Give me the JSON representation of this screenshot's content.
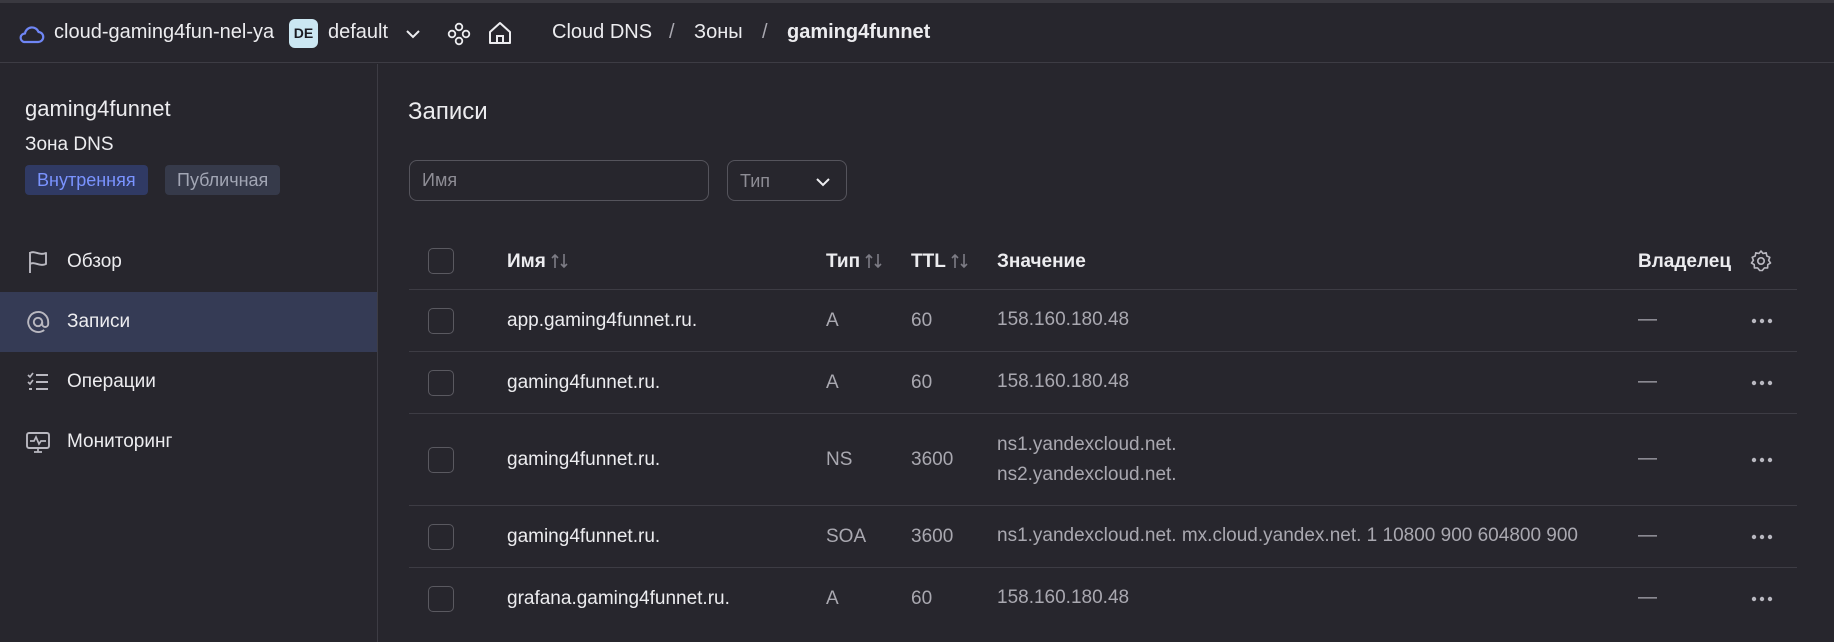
{
  "header": {
    "cloud_name": "cloud-gaming4fun-nel-ya",
    "folder_badge": "DE",
    "folder_name": "default",
    "breadcrumbs": [
      {
        "label": "Cloud DNS"
      },
      {
        "label": "Зоны"
      },
      {
        "label": "gaming4funnet"
      }
    ],
    "separator": "/"
  },
  "sidebar": {
    "zone_title": "gaming4funnet",
    "zone_subtitle": "Зона DNS",
    "tags": [
      {
        "label": "Внутренняя",
        "active": true
      },
      {
        "label": "Публичная",
        "active": false
      }
    ],
    "items": [
      {
        "label": "Обзор",
        "icon": "flag-icon",
        "active": false
      },
      {
        "label": "Записи",
        "icon": "at-icon",
        "active": true
      },
      {
        "label": "Операции",
        "icon": "checklist-icon",
        "active": false
      },
      {
        "label": "Мониторинг",
        "icon": "monitor-icon",
        "active": false
      }
    ]
  },
  "main": {
    "title": "Записи",
    "filter_name_placeholder": "Имя",
    "filter_type_placeholder": "Тип",
    "columns": {
      "name": "Имя",
      "type": "Тип",
      "ttl": "TTL",
      "value": "Значение",
      "owner": "Владелец"
    },
    "rows": [
      {
        "name": "app.gaming4funnet.ru.",
        "type": "A",
        "ttl": "60",
        "value": [
          "158.160.180.48"
        ],
        "owner": "—"
      },
      {
        "name": "gaming4funnet.ru.",
        "type": "A",
        "ttl": "60",
        "value": [
          "158.160.180.48"
        ],
        "owner": "—"
      },
      {
        "name": "gaming4funnet.ru.",
        "type": "NS",
        "ttl": "3600",
        "value": [
          "ns1.yandexcloud.net.",
          "ns2.yandexcloud.net."
        ],
        "owner": "—"
      },
      {
        "name": "gaming4funnet.ru.",
        "type": "SOA",
        "ttl": "3600",
        "value": [
          "ns1.yandexcloud.net. mx.cloud.yandex.net. 1 10800 900 604800 900"
        ],
        "owner": "—"
      },
      {
        "name": "grafana.gaming4funnet.ru.",
        "type": "A",
        "ttl": "60",
        "value": [
          "158.160.180.48"
        ],
        "owner": "—"
      }
    ]
  },
  "colors": {
    "background": "#27262d",
    "accent": "#7a93ff",
    "active_nav": "#353b55",
    "badge": "#cbe7f2"
  }
}
